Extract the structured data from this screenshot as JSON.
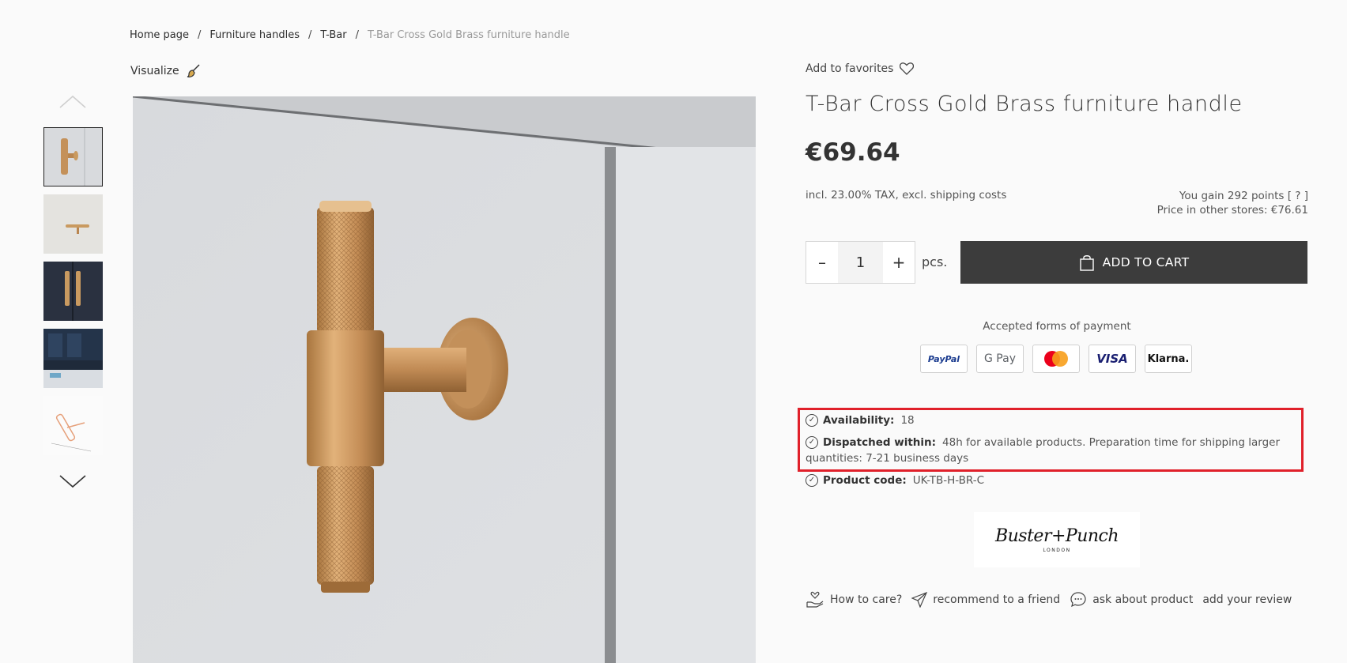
{
  "breadcrumb": {
    "items": [
      "Home page",
      "Furniture handles",
      "T-Bar"
    ],
    "current": "T-Bar Cross Gold Brass furniture handle",
    "separator": "/"
  },
  "visualize_label": "Visualize",
  "favorites_label": "Add to favorites",
  "product": {
    "title": "T-Bar Cross Gold Brass furniture handle",
    "price": "€69.64",
    "tax_note": "incl. 23.00% TAX, excl. shipping costs",
    "points": "You gain 292 points [ ? ]",
    "other_stores": "Price in other stores: €76.61",
    "quantity": "1",
    "unit": "pcs.",
    "add_to_cart": "ADD TO CART"
  },
  "payment": {
    "label": "Accepted forms of payment",
    "methods": [
      "PayPal",
      "G Pay",
      "Mastercard",
      "VISA",
      "Klarna."
    ]
  },
  "details": {
    "availability_label": "Availability:",
    "availability_value": "18",
    "dispatch_label": "Dispatched within:",
    "dispatch_value_1": "48h for available products. Preparation time for shipping larger",
    "dispatch_value_2": "quantities: 7-21 business days",
    "code_label": "Product code:",
    "code_value": "UK-TB-H-BR-C"
  },
  "brand": {
    "name": "Buster+Punch",
    "sub": "LONDON"
  },
  "actions": {
    "care": "How to care?",
    "recommend": "recommend to a friend",
    "ask": "ask about product",
    "review": "add your review"
  },
  "colors": {
    "highlight": "#e0202a",
    "cart_button": "#3c3c3c",
    "brass": "#c99a60"
  }
}
